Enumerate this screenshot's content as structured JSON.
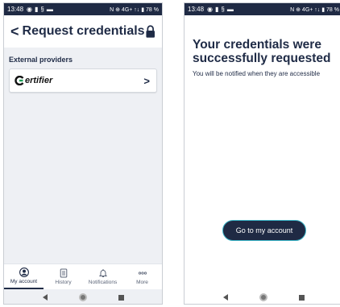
{
  "status_bar": {
    "time": "13:48",
    "right_text": "N ⊕ 4G+ ↑↓ ▮ 78 %"
  },
  "left_screen": {
    "header": {
      "back_symbol": "<",
      "title": "Request credentials",
      "lock_icon": "lock-icon"
    },
    "section_label": "External providers",
    "provider": {
      "name": "ertifier",
      "chevron": ">"
    },
    "bottom_nav": [
      {
        "label": "My account",
        "icon": "account-icon",
        "active": true
      },
      {
        "label": "History",
        "icon": "history-icon",
        "active": false
      },
      {
        "label": "Notifications",
        "icon": "bell-icon",
        "active": false
      },
      {
        "label": "More",
        "icon": "more-icon",
        "active": false
      }
    ]
  },
  "right_screen": {
    "title": "Your credentials were successfully requested",
    "subtitle": "You will be notified when they are accessible",
    "button_label": "Go to my account"
  },
  "colors": {
    "navy": "#1f2a44",
    "accent": "#3bb5c8",
    "content_bg": "#eef0f4"
  }
}
